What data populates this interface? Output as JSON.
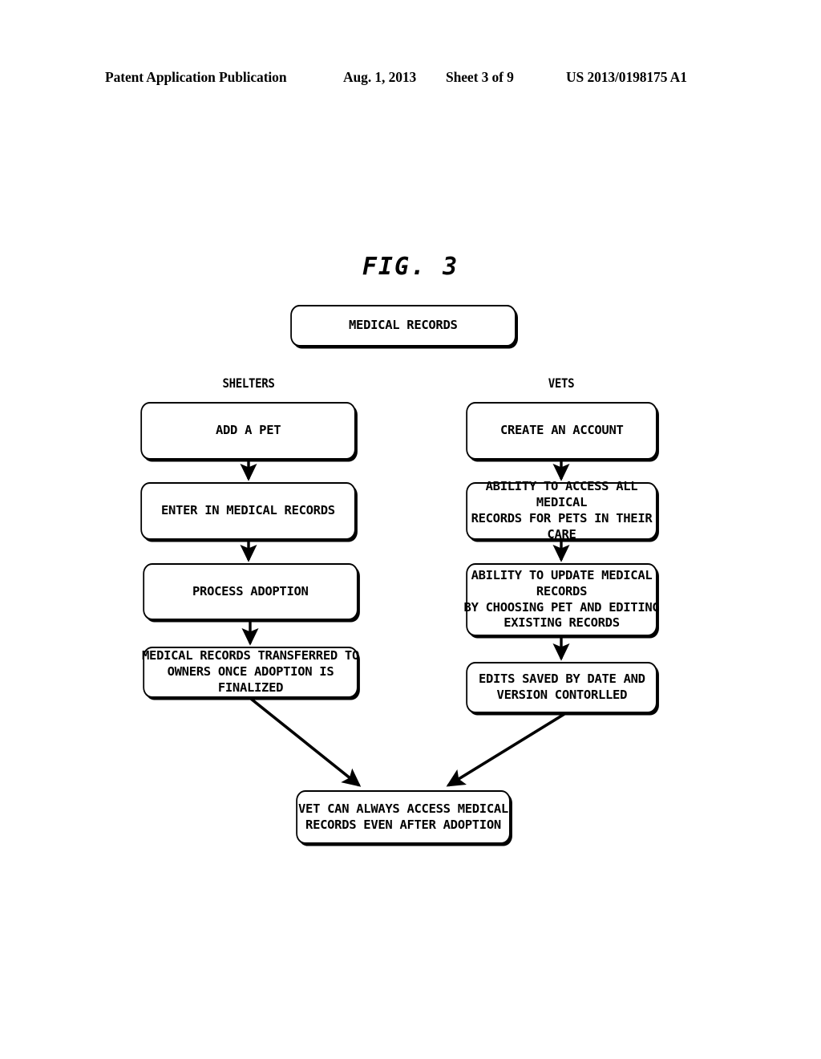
{
  "header": {
    "publication": "Patent Application Publication",
    "date": "Aug. 1, 2013",
    "sheet": "Sheet 3 of 9",
    "patent_number": "US 2013/0198175 A1"
  },
  "figure": {
    "title": "FIG. 3"
  },
  "diagram": {
    "type": "flowchart",
    "root": {
      "id": "node-top",
      "label": "MEDICAL RECORDS"
    },
    "columns": [
      {
        "id": "shelters",
        "caption": "SHELTERS",
        "nodes": [
          {
            "id": "node-l1",
            "label": "ADD A PET"
          },
          {
            "id": "node-l2",
            "label": "ENTER IN MEDICAL RECORDS"
          },
          {
            "id": "node-l3",
            "label": "PROCESS ADOPTION"
          },
          {
            "id": "node-l4",
            "label": "MEDICAL RECORDS TRANSFERRED TO\nOWNERS ONCE ADOPTION IS FINALIZED"
          }
        ]
      },
      {
        "id": "vets",
        "caption": "VETS",
        "nodes": [
          {
            "id": "node-r1",
            "label": "CREATE AN ACCOUNT"
          },
          {
            "id": "node-r2",
            "label": "ABILITY TO ACCESS ALL MEDICAL\nRECORDS FOR PETS IN THEIR CARE"
          },
          {
            "id": "node-r3",
            "label": "ABILITY TO UPDATE MEDICAL RECORDS\nBY CHOOSING PET AND EDITING\nEXISTING RECORDS"
          },
          {
            "id": "node-r4",
            "label": "EDITS SAVED BY DATE AND\nVERSION CONTORLLED"
          }
        ]
      }
    ],
    "terminal": {
      "id": "node-bottom",
      "label": "VET CAN ALWAYS ACCESS MEDICAL\nRECORDS EVEN AFTER ADOPTION"
    },
    "edges": [
      {
        "from": "node-l1",
        "to": "node-l2",
        "style": "vertical-arrow"
      },
      {
        "from": "node-l2",
        "to": "node-l3",
        "style": "vertical-arrow"
      },
      {
        "from": "node-l3",
        "to": "node-l4",
        "style": "vertical-arrow"
      },
      {
        "from": "node-r1",
        "to": "node-r2",
        "style": "vertical-arrow"
      },
      {
        "from": "node-r2",
        "to": "node-r3",
        "style": "vertical-arrow"
      },
      {
        "from": "node-r3",
        "to": "node-r4",
        "style": "vertical-arrow"
      },
      {
        "from": "node-l4",
        "to": "node-bottom",
        "style": "diagonal-arrow"
      },
      {
        "from": "node-r4",
        "to": "node-bottom",
        "style": "diagonal-arrow"
      }
    ]
  },
  "colors": {
    "ink": "#000000",
    "paper": "#ffffff"
  }
}
